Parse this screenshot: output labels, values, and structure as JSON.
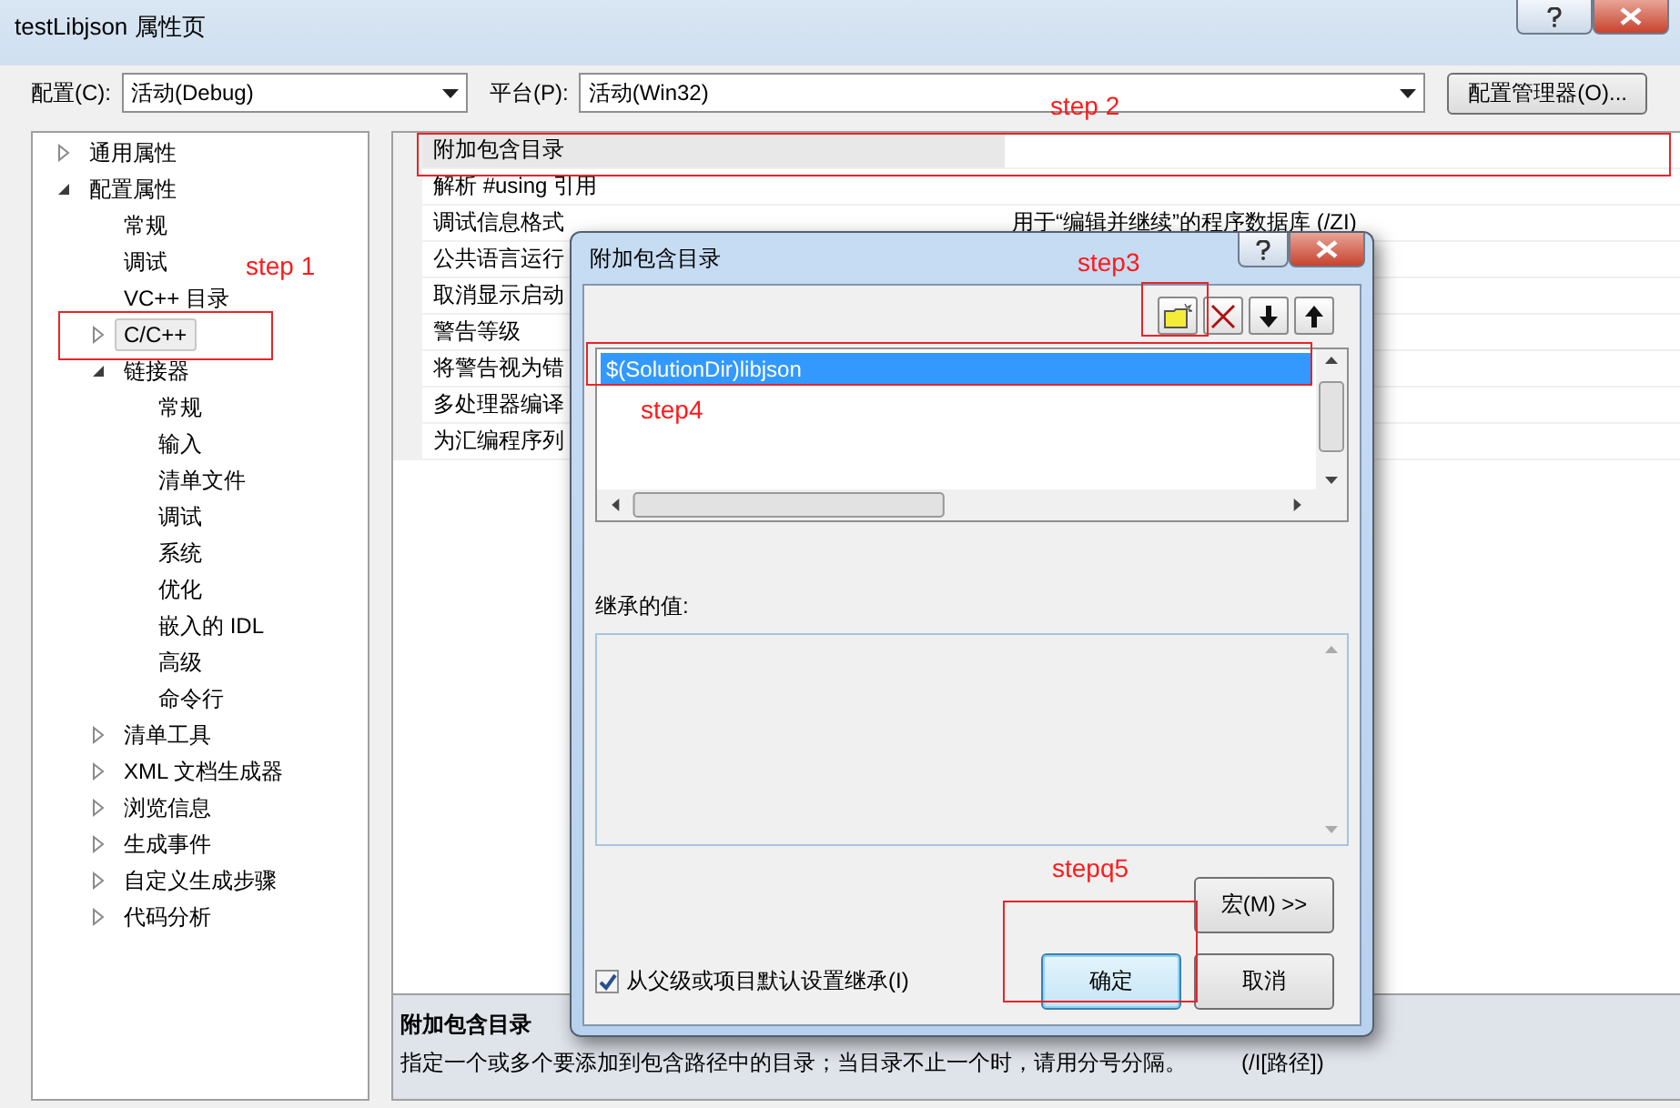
{
  "window": {
    "title": "testLibjson 属性页"
  },
  "toolbar": {
    "config_label": "配置(C):",
    "config_value": "活动(Debug)",
    "platform_label": "平台(P):",
    "platform_value": "活动(Win32)",
    "manager_button": "配置管理器(O)..."
  },
  "tree": [
    {
      "label": "通用属性",
      "expanded": false,
      "selected": false
    },
    {
      "label": "配置属性",
      "expanded": true,
      "selected": false,
      "children": [
        {
          "label": "常规",
          "selected": false
        },
        {
          "label": "调试",
          "selected": false
        },
        {
          "label": "VC++ 目录",
          "selected": false
        },
        {
          "label": "C/C++",
          "expanded": false,
          "selected": true
        },
        {
          "label": "链接器",
          "expanded": true,
          "selected": false,
          "children": [
            {
              "label": "常规",
              "selected": false
            },
            {
              "label": "输入",
              "selected": false
            },
            {
              "label": "清单文件",
              "selected": false
            },
            {
              "label": "调试",
              "selected": false
            },
            {
              "label": "系统",
              "selected": false
            },
            {
              "label": "优化",
              "selected": false
            },
            {
              "label": "嵌入的 IDL",
              "selected": false
            },
            {
              "label": "高级",
              "selected": false
            },
            {
              "label": "命令行",
              "selected": false
            }
          ]
        },
        {
          "label": "清单工具",
          "expanded": false,
          "selected": false
        },
        {
          "label": "XML 文档生成器",
          "expanded": false,
          "selected": false
        },
        {
          "label": "浏览信息",
          "expanded": false,
          "selected": false
        },
        {
          "label": "生成事件",
          "expanded": false,
          "selected": false
        },
        {
          "label": "自定义生成步骤",
          "expanded": false,
          "selected": false
        },
        {
          "label": "代码分析",
          "expanded": false,
          "selected": false
        }
      ]
    }
  ],
  "properties": [
    {
      "name": "附加包含目录",
      "selected": true
    },
    {
      "name": "解析 #using 引用",
      "selected": false
    },
    {
      "name": "调试信息格式",
      "value": "用于“编辑并继续”的程序数据库 (/ZI)",
      "selected": false
    },
    {
      "name": "公共语言运行",
      "selected": false
    },
    {
      "name": "取消显示启动",
      "selected": false
    },
    {
      "name": "警告等级",
      "selected": false
    },
    {
      "name": "将警告视为错",
      "selected": false
    },
    {
      "name": "多处理器编译",
      "selected": false
    },
    {
      "name": "为汇编程序列",
      "selected": false
    }
  ],
  "description": {
    "title": "附加包含目录",
    "text": "指定一个或多个要添加到包含路径中的目录；当目录不止一个时，请用分号分隔。",
    "switch": "(/I[路径])"
  },
  "dialog": {
    "title": "附加包含目录",
    "entries": [
      {
        "text": "$(SolutionDir)libjson",
        "selected": true
      }
    ],
    "inherited_label": "继承的值:",
    "inherit_checkbox": {
      "label": "从父级或项目默认设置继承(I)",
      "checked": true
    },
    "macro_button": "宏(M) >>",
    "ok_button": "确定",
    "cancel_button": "取消"
  },
  "annotations": [
    {
      "text": "step 1"
    },
    {
      "text": "step 2"
    },
    {
      "text": "step3"
    },
    {
      "text": "step4"
    },
    {
      "text": "stepq5"
    }
  ]
}
